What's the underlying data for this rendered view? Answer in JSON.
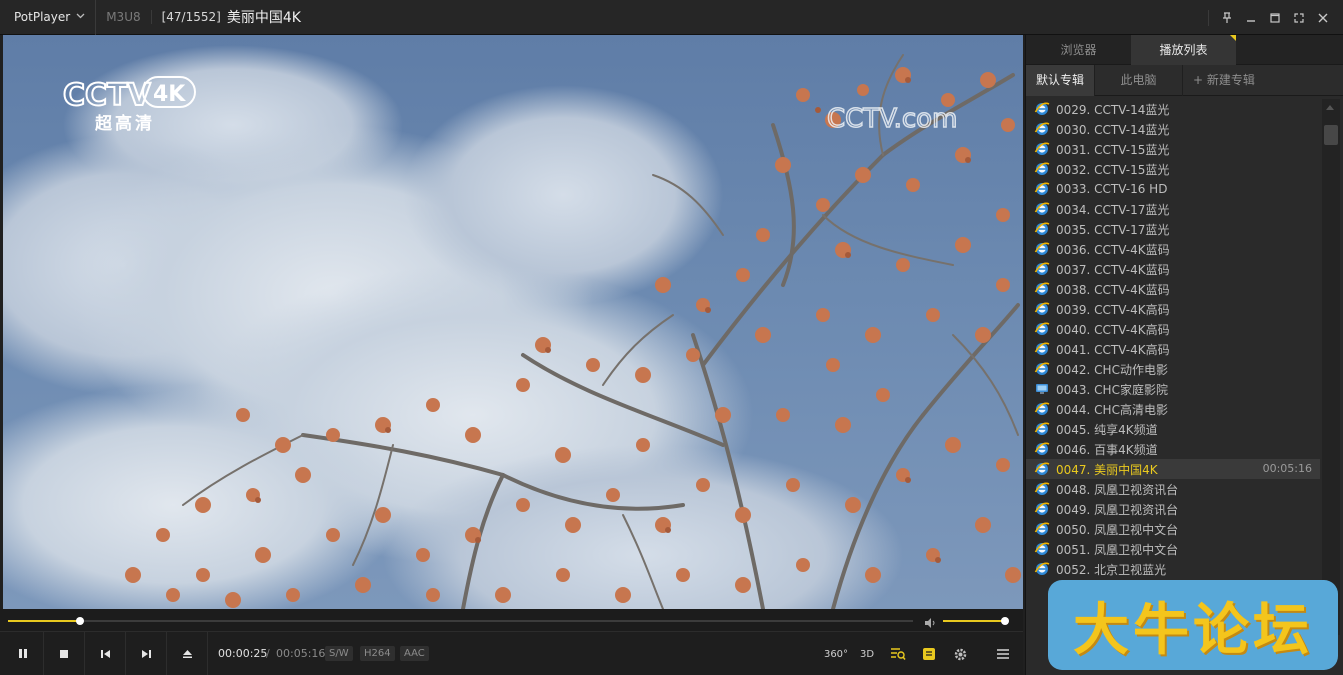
{
  "app": {
    "name": "PotPlayer",
    "format": "M3U8",
    "position": "[47/1552]",
    "title": "美丽中国4K"
  },
  "icons": {
    "brand_caret": "chevron-down-icon",
    "window": [
      "pin-icon",
      "minimize-icon",
      "maximize-icon",
      "fullscreen-icon",
      "close-icon"
    ]
  },
  "colors": {
    "accent": "#e9c91f",
    "background": "#202020",
    "sidebar": "#2a2a2a"
  },
  "video": {
    "logo_line1": "CCTV",
    "logo_badge": "4K",
    "logo_sub": "超高清",
    "watermark": "CCTV.com"
  },
  "playback": {
    "seek_fraction": 0.08,
    "volume_fraction": 0.94,
    "time_current": "00:00:25",
    "time_separator": "/",
    "time_total": "00:05:16",
    "badges": [
      "S/W",
      "H264",
      "AAC"
    ],
    "icons_right": [
      "360-icon",
      "3d-icon",
      "playlist-search-icon",
      "subtitle-icon",
      "settings-icon",
      "menu-icon"
    ],
    "label_360": "360°",
    "label_3d": "3D"
  },
  "sidebar": {
    "tabs": [
      {
        "label": "浏览器"
      },
      {
        "label": "播放列表"
      }
    ],
    "subtabs": [
      {
        "label": "默认专辑"
      },
      {
        "label": "此电脑"
      },
      {
        "label": "+ 新建专辑"
      }
    ],
    "items": [
      {
        "label": "0029. CCTV-14蓝光"
      },
      {
        "label": "0030. CCTV-14蓝光"
      },
      {
        "label": "0031. CCTV-15蓝光"
      },
      {
        "label": "0032. CCTV-15蓝光"
      },
      {
        "label": "0033. CCTV-16 HD"
      },
      {
        "label": "0034. CCTV-17蓝光"
      },
      {
        "label": "0035. CCTV-17蓝光"
      },
      {
        "label": "0036. CCTV-4K蓝码"
      },
      {
        "label": "0037. CCTV-4K蓝码"
      },
      {
        "label": "0038. CCTV-4K蓝码"
      },
      {
        "label": "0039. CCTV-4K高码"
      },
      {
        "label": "0040. CCTV-4K高码"
      },
      {
        "label": "0041. CCTV-4K高码"
      },
      {
        "label": "0042. CHC动作电影"
      },
      {
        "label": "0043. CHC家庭影院"
      },
      {
        "label": "0044. CHC高清电影"
      },
      {
        "label": "0045. 纯享4K频道"
      },
      {
        "label": "0046. 百事4K频道"
      },
      {
        "label": "0047. 美丽中国4K",
        "duration": "00:05:16"
      },
      {
        "label": "0048. 凤凰卫视资讯台"
      },
      {
        "label": "0049. 凤凰卫视资讯台"
      },
      {
        "label": "0050. 凤凰卫视中文台"
      },
      {
        "label": "0051. 凤凰卫视中文台"
      },
      {
        "label": "0052. 北京卫视蓝光"
      }
    ]
  },
  "overlay_watermark": "大牛论坛"
}
